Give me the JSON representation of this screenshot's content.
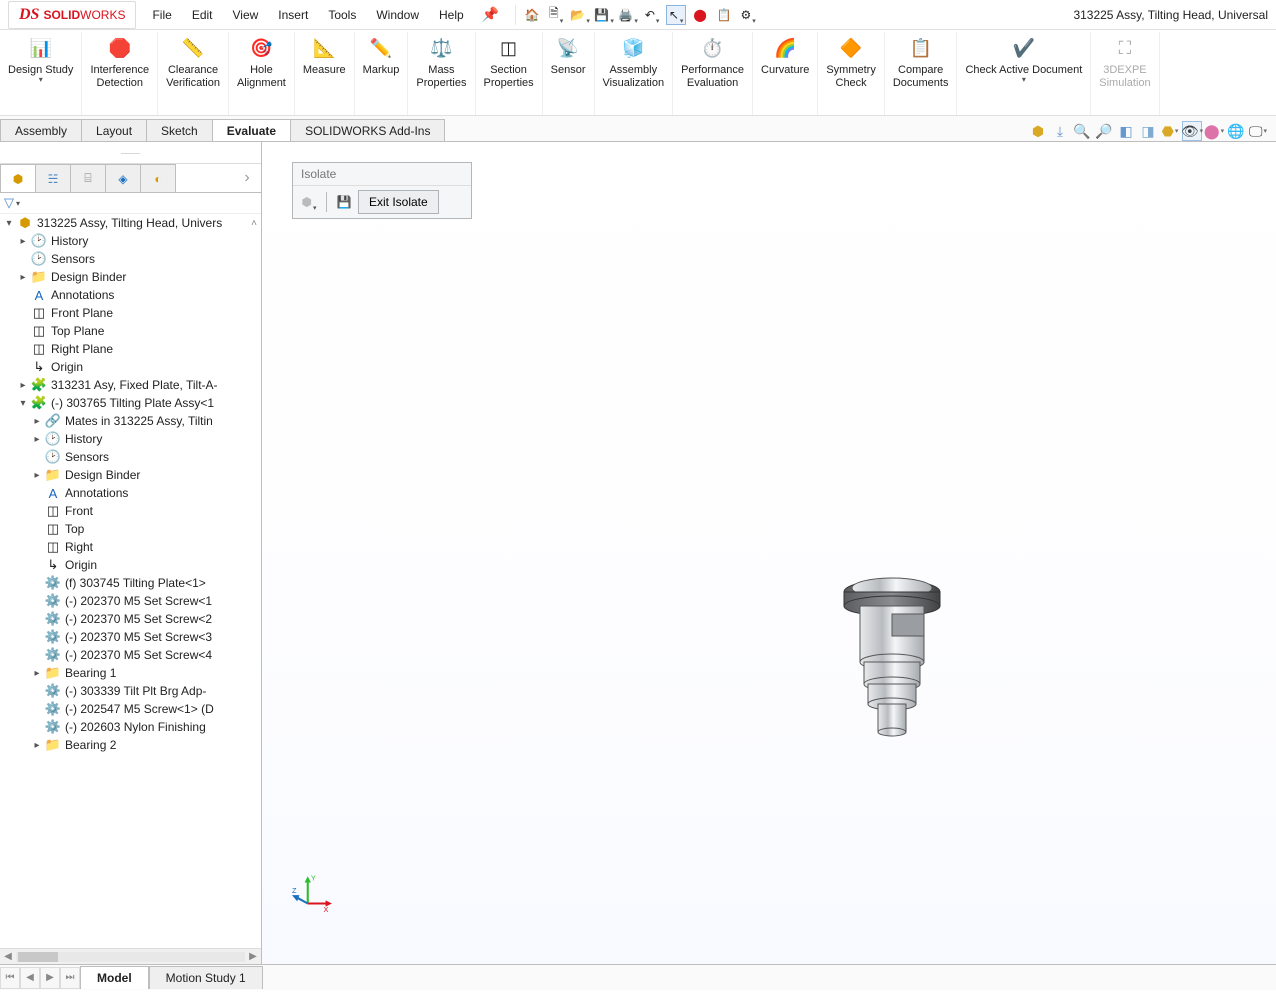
{
  "app": {
    "brand_ds": "DS",
    "brand_solid": "SOLID",
    "brand_works": "WORKS",
    "document_title": "313225 Assy, Tilting Head, Universal"
  },
  "menu": [
    "File",
    "Edit",
    "View",
    "Insert",
    "Tools",
    "Window",
    "Help"
  ],
  "ribbon": [
    {
      "label": "Design Study",
      "icon": "📊",
      "dropdown": true
    },
    {
      "label": "Interference\nDetection",
      "icon": "🛑"
    },
    {
      "label": "Clearance\nVerification",
      "icon": "📏"
    },
    {
      "label": "Hole\nAlignment",
      "icon": "🎯"
    },
    {
      "label": "Measure",
      "icon": "📐"
    },
    {
      "label": "Markup",
      "icon": "✏️"
    },
    {
      "label": "Mass\nProperties",
      "icon": "⚖️"
    },
    {
      "label": "Section\nProperties",
      "icon": "◫"
    },
    {
      "label": "Sensor",
      "icon": "📡"
    },
    {
      "label": "Assembly\nVisualization",
      "icon": "🧊"
    },
    {
      "label": "Performance\nEvaluation",
      "icon": "⏱️"
    },
    {
      "label": "Curvature",
      "icon": "🌈"
    },
    {
      "label": "Symmetry\nCheck",
      "icon": "🔶"
    },
    {
      "label": "Compare\nDocuments",
      "icon": "📋"
    },
    {
      "label": "Check Active Document",
      "icon": "✔️",
      "dropdown": true
    },
    {
      "label": "3DEXPE\nSimulation",
      "icon": "⛶",
      "disabled": true
    }
  ],
  "tabs": {
    "items": [
      "Assembly",
      "Layout",
      "Sketch",
      "Evaluate",
      "SOLIDWORKS Add-Ins"
    ],
    "active": "Evaluate"
  },
  "isolate": {
    "title": "Isolate",
    "exit_label": "Exit Isolate"
  },
  "tree": {
    "root": "313225 Assy, Tilting Head, Univers",
    "items": [
      {
        "label": "History",
        "twist": "▸",
        "icon": "🕑",
        "ind": 1
      },
      {
        "label": "Sensors",
        "twist": "",
        "icon": "🕑",
        "ind": 1
      },
      {
        "label": "Design Binder",
        "twist": "▸",
        "icon": "📁",
        "ind": 1
      },
      {
        "label": "Annotations",
        "twist": "",
        "icon": "A",
        "ind": 1,
        "color": "#1565c0"
      },
      {
        "label": "Front Plane",
        "twist": "",
        "icon": "◫",
        "ind": 1
      },
      {
        "label": "Top Plane",
        "twist": "",
        "icon": "◫",
        "ind": 1
      },
      {
        "label": "Right Plane",
        "twist": "",
        "icon": "◫",
        "ind": 1
      },
      {
        "label": "Origin",
        "twist": "",
        "icon": "↳",
        "ind": 1
      },
      {
        "label": "313231 Asy, Fixed Plate, Tilt-A-",
        "twist": "▸",
        "icon": "🧩",
        "ind": 1,
        "color": "#c9a100"
      },
      {
        "label": "(-) 303765 Tilting Plate Assy<1",
        "twist": "▾",
        "icon": "🧩",
        "ind": 1,
        "color": "#c9a100"
      },
      {
        "label": "Mates in 313225 Assy, Tiltin",
        "twist": "▸",
        "icon": "🔗",
        "ind": 2
      },
      {
        "label": "History",
        "twist": "▸",
        "icon": "🕑",
        "ind": 2
      },
      {
        "label": "Sensors",
        "twist": "",
        "icon": "🕑",
        "ind": 2
      },
      {
        "label": "Design Binder",
        "twist": "▸",
        "icon": "📁",
        "ind": 2
      },
      {
        "label": "Annotations",
        "twist": "",
        "icon": "A",
        "ind": 2,
        "color": "#1565c0"
      },
      {
        "label": "Front",
        "twist": "",
        "icon": "◫",
        "ind": 2
      },
      {
        "label": "Top",
        "twist": "",
        "icon": "◫",
        "ind": 2
      },
      {
        "label": "Right",
        "twist": "",
        "icon": "◫",
        "ind": 2
      },
      {
        "label": "Origin",
        "twist": "",
        "icon": "↳",
        "ind": 2
      },
      {
        "label": "(f) 303745 Tilting Plate<1>",
        "twist": "",
        "icon": "⚙️",
        "ind": 2
      },
      {
        "label": "(-) 202370 M5 Set Screw<1",
        "twist": "",
        "icon": "⚙️",
        "ind": 2
      },
      {
        "label": "(-) 202370 M5 Set Screw<2",
        "twist": "",
        "icon": "⚙️",
        "ind": 2
      },
      {
        "label": "(-) 202370 M5 Set Screw<3",
        "twist": "",
        "icon": "⚙️",
        "ind": 2
      },
      {
        "label": "(-) 202370 M5 Set Screw<4",
        "twist": "",
        "icon": "⚙️",
        "ind": 2
      },
      {
        "label": "Bearing 1",
        "twist": "▸",
        "icon": "📁",
        "ind": 2
      },
      {
        "label": "(-) 303339 Tilt Plt Brg Adp-",
        "twist": "",
        "icon": "⚙️",
        "ind": 2
      },
      {
        "label": "(-) 202547 M5 Screw<1> (D",
        "twist": "",
        "icon": "⚙️",
        "ind": 2
      },
      {
        "label": "(-) 202603 Nylon Finishing",
        "twist": "",
        "icon": "⚙️",
        "ind": 2
      },
      {
        "label": "Bearing 2",
        "twist": "▸",
        "icon": "📁",
        "ind": 2
      }
    ]
  },
  "bottom_tabs": {
    "items": [
      "Model",
      "Motion Study 1"
    ],
    "active": "Model"
  }
}
